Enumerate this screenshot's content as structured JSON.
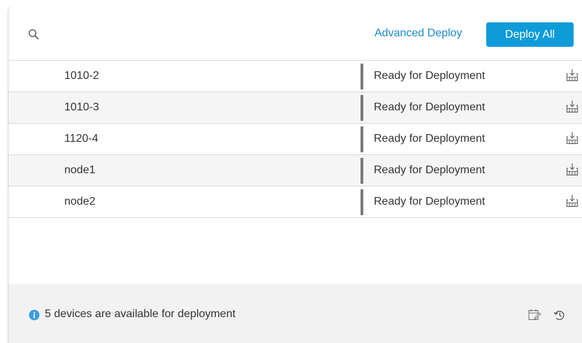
{
  "toolbar": {
    "search_icon": "search-icon",
    "advanced_deploy_label": "Advanced Deploy",
    "deploy_all_label": "Deploy All"
  },
  "devices": [
    {
      "name": "1010-2",
      "status": "Ready for Deployment",
      "action_icon": "deploy-icon"
    },
    {
      "name": "1010-3",
      "status": "Ready for Deployment",
      "action_icon": "deploy-icon"
    },
    {
      "name": "1120-4",
      "status": "Ready for Deployment",
      "action_icon": "deploy-icon"
    },
    {
      "name": "node1",
      "status": "Ready for Deployment",
      "action_icon": "deploy-icon"
    },
    {
      "name": "node2",
      "status": "Ready for Deployment",
      "action_icon": "deploy-icon"
    }
  ],
  "footer": {
    "message": "5 devices are available for deployment",
    "info_icon": "info-icon",
    "schedule_icon": "schedule-icon",
    "history_icon": "history-icon"
  },
  "colors": {
    "accent": "#0d9bd9",
    "link": "#1a8ac9",
    "status_bar": "#7b7b7b",
    "info": "#3a9ee0"
  }
}
